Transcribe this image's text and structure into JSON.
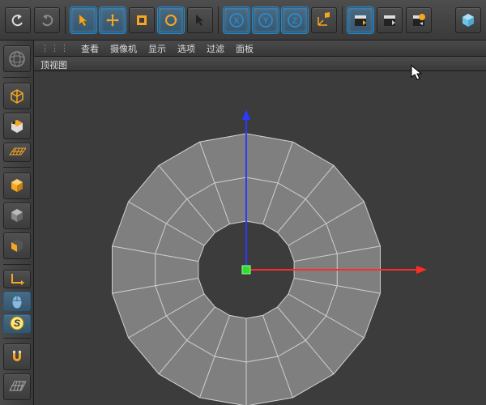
{
  "app": "Cinema 4D",
  "topbar": {
    "groups": {
      "hist": [
        "undo",
        "redo"
      ],
      "tools": [
        "select",
        "move",
        "scale",
        "rotate",
        "lasso"
      ],
      "axis": [
        "x",
        "y",
        "z",
        "axis-mode"
      ],
      "anim": [
        "anim-a",
        "anim-b",
        "anim-c"
      ],
      "view": [
        "viewcube"
      ]
    }
  },
  "leftbar": {
    "items": [
      "globe",
      "make-editable",
      "group1",
      "group2",
      "model",
      "obj",
      "poly",
      "edge",
      "axis-handle",
      "mouse-mode",
      "s-mode",
      "magnet",
      "workplane"
    ]
  },
  "viewport": {
    "menu": [
      "查看",
      "摄像机",
      "显示",
      "选项",
      "过滤",
      "面板"
    ],
    "grip_label": "",
    "label": "顶视图",
    "geometry": {
      "type": "tube",
      "center": [
        262,
        245
      ],
      "r_inner": 60,
      "r_outer": 168,
      "segments": 18,
      "cap_segments": 2,
      "fill": "#7f7f7f",
      "edge": "#d0d0d0"
    },
    "axes": {
      "x": {
        "len": 210,
        "color": "#ff2a2a"
      },
      "z": {
        "len": 185,
        "color": "#2a3aff"
      },
      "gizmo": {
        "size": 10,
        "fill": "#2ee02e",
        "stroke": "#9dff9d"
      }
    }
  },
  "colors": {
    "orange": "#f5a623",
    "blue": "#2f86c0",
    "cyan": "#6ec2e8",
    "green": "#2ee02e",
    "red": "#ff2a2a"
  }
}
